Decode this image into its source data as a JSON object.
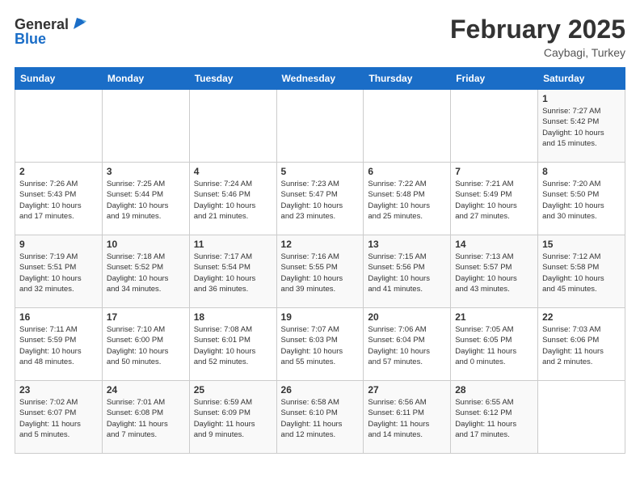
{
  "header": {
    "logo_line1": "General",
    "logo_line2": "Blue",
    "month": "February 2025",
    "location": "Caybagi, Turkey"
  },
  "days_of_week": [
    "Sunday",
    "Monday",
    "Tuesday",
    "Wednesday",
    "Thursday",
    "Friday",
    "Saturday"
  ],
  "weeks": [
    [
      {
        "day": "",
        "info": ""
      },
      {
        "day": "",
        "info": ""
      },
      {
        "day": "",
        "info": ""
      },
      {
        "day": "",
        "info": ""
      },
      {
        "day": "",
        "info": ""
      },
      {
        "day": "",
        "info": ""
      },
      {
        "day": "1",
        "info": "Sunrise: 7:27 AM\nSunset: 5:42 PM\nDaylight: 10 hours\nand 15 minutes."
      }
    ],
    [
      {
        "day": "2",
        "info": "Sunrise: 7:26 AM\nSunset: 5:43 PM\nDaylight: 10 hours\nand 17 minutes."
      },
      {
        "day": "3",
        "info": "Sunrise: 7:25 AM\nSunset: 5:44 PM\nDaylight: 10 hours\nand 19 minutes."
      },
      {
        "day": "4",
        "info": "Sunrise: 7:24 AM\nSunset: 5:46 PM\nDaylight: 10 hours\nand 21 minutes."
      },
      {
        "day": "5",
        "info": "Sunrise: 7:23 AM\nSunset: 5:47 PM\nDaylight: 10 hours\nand 23 minutes."
      },
      {
        "day": "6",
        "info": "Sunrise: 7:22 AM\nSunset: 5:48 PM\nDaylight: 10 hours\nand 25 minutes."
      },
      {
        "day": "7",
        "info": "Sunrise: 7:21 AM\nSunset: 5:49 PM\nDaylight: 10 hours\nand 27 minutes."
      },
      {
        "day": "8",
        "info": "Sunrise: 7:20 AM\nSunset: 5:50 PM\nDaylight: 10 hours\nand 30 minutes."
      }
    ],
    [
      {
        "day": "9",
        "info": "Sunrise: 7:19 AM\nSunset: 5:51 PM\nDaylight: 10 hours\nand 32 minutes."
      },
      {
        "day": "10",
        "info": "Sunrise: 7:18 AM\nSunset: 5:52 PM\nDaylight: 10 hours\nand 34 minutes."
      },
      {
        "day": "11",
        "info": "Sunrise: 7:17 AM\nSunset: 5:54 PM\nDaylight: 10 hours\nand 36 minutes."
      },
      {
        "day": "12",
        "info": "Sunrise: 7:16 AM\nSunset: 5:55 PM\nDaylight: 10 hours\nand 39 minutes."
      },
      {
        "day": "13",
        "info": "Sunrise: 7:15 AM\nSunset: 5:56 PM\nDaylight: 10 hours\nand 41 minutes."
      },
      {
        "day": "14",
        "info": "Sunrise: 7:13 AM\nSunset: 5:57 PM\nDaylight: 10 hours\nand 43 minutes."
      },
      {
        "day": "15",
        "info": "Sunrise: 7:12 AM\nSunset: 5:58 PM\nDaylight: 10 hours\nand 45 minutes."
      }
    ],
    [
      {
        "day": "16",
        "info": "Sunrise: 7:11 AM\nSunset: 5:59 PM\nDaylight: 10 hours\nand 48 minutes."
      },
      {
        "day": "17",
        "info": "Sunrise: 7:10 AM\nSunset: 6:00 PM\nDaylight: 10 hours\nand 50 minutes."
      },
      {
        "day": "18",
        "info": "Sunrise: 7:08 AM\nSunset: 6:01 PM\nDaylight: 10 hours\nand 52 minutes."
      },
      {
        "day": "19",
        "info": "Sunrise: 7:07 AM\nSunset: 6:03 PM\nDaylight: 10 hours\nand 55 minutes."
      },
      {
        "day": "20",
        "info": "Sunrise: 7:06 AM\nSunset: 6:04 PM\nDaylight: 10 hours\nand 57 minutes."
      },
      {
        "day": "21",
        "info": "Sunrise: 7:05 AM\nSunset: 6:05 PM\nDaylight: 11 hours\nand 0 minutes."
      },
      {
        "day": "22",
        "info": "Sunrise: 7:03 AM\nSunset: 6:06 PM\nDaylight: 11 hours\nand 2 minutes."
      }
    ],
    [
      {
        "day": "23",
        "info": "Sunrise: 7:02 AM\nSunset: 6:07 PM\nDaylight: 11 hours\nand 5 minutes."
      },
      {
        "day": "24",
        "info": "Sunrise: 7:01 AM\nSunset: 6:08 PM\nDaylight: 11 hours\nand 7 minutes."
      },
      {
        "day": "25",
        "info": "Sunrise: 6:59 AM\nSunset: 6:09 PM\nDaylight: 11 hours\nand 9 minutes."
      },
      {
        "day": "26",
        "info": "Sunrise: 6:58 AM\nSunset: 6:10 PM\nDaylight: 11 hours\nand 12 minutes."
      },
      {
        "day": "27",
        "info": "Sunrise: 6:56 AM\nSunset: 6:11 PM\nDaylight: 11 hours\nand 14 minutes."
      },
      {
        "day": "28",
        "info": "Sunrise: 6:55 AM\nSunset: 6:12 PM\nDaylight: 11 hours\nand 17 minutes."
      },
      {
        "day": "",
        "info": ""
      }
    ]
  ]
}
